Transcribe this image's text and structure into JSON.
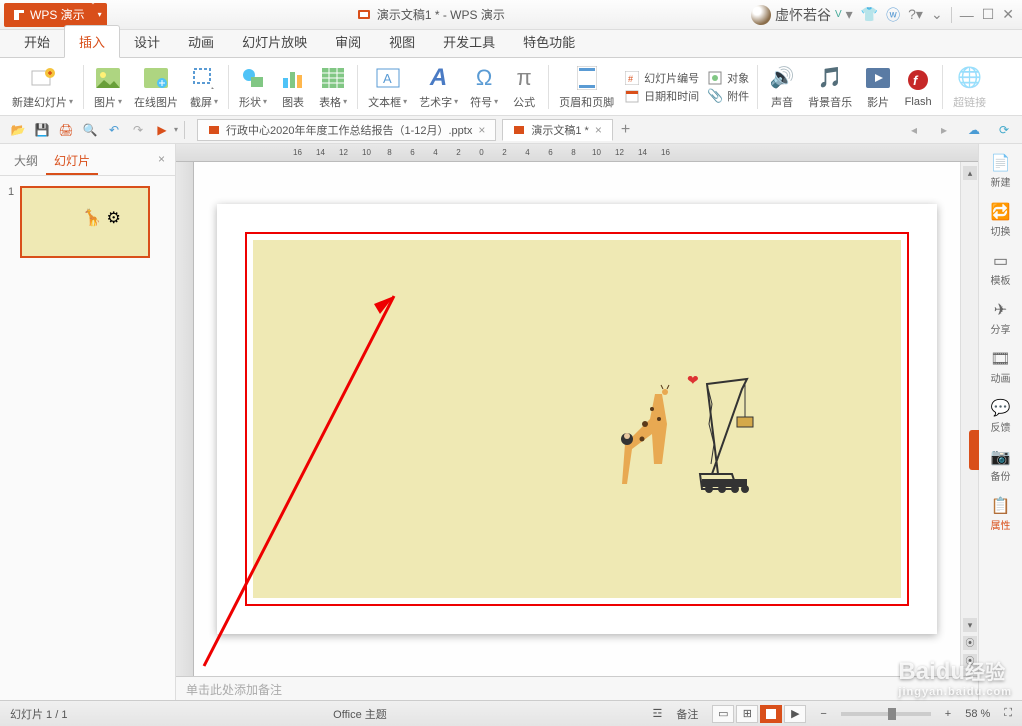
{
  "title": {
    "app": "WPS 演示",
    "doc": "演示文稿1 *",
    "full": "演示文稿1 * - WPS 演示",
    "user": "虚怀若谷"
  },
  "menu": [
    "开始",
    "插入",
    "设计",
    "动画",
    "幻灯片放映",
    "审阅",
    "视图",
    "开发工具",
    "特色功能"
  ],
  "menu_active": 1,
  "ribbon": {
    "new_slide": "新建幻灯片",
    "image": "图片",
    "online_img": "在线图片",
    "screenshot": "截屏",
    "shapes": "形状",
    "chart": "图表",
    "table": "表格",
    "textbox": "文本框",
    "wordart": "艺术字",
    "symbol": "符号",
    "formula": "公式",
    "header_footer": "页眉和页脚",
    "slide_num": "幻灯片编号",
    "date_time": "日期和时间",
    "object": "对象",
    "attachment": "附件",
    "audio": "声音",
    "bgm": "背景音乐",
    "movie": "影片",
    "flash": "Flash",
    "hyperlink": "超链接"
  },
  "doc_tabs": [
    {
      "name": "行政中心2020年年度工作总结报告（1-12月）.pptx",
      "active": false
    },
    {
      "name": "演示文稿1 *",
      "active": true
    }
  ],
  "thumb": {
    "tabs": [
      "大纲",
      "幻灯片"
    ],
    "active": 1,
    "slides": [
      {
        "num": "1"
      }
    ]
  },
  "ruler_marks": [
    "16",
    "14",
    "12",
    "10",
    "8",
    "6",
    "4",
    "2",
    "0",
    "2",
    "4",
    "6",
    "8",
    "10",
    "12",
    "14",
    "16"
  ],
  "notes_placeholder": "单击此处添加备注",
  "sidebar": [
    {
      "icon": "📄",
      "label": "新建"
    },
    {
      "icon": "🔁",
      "label": "切换"
    },
    {
      "icon": "▭",
      "label": "模板"
    },
    {
      "icon": "✈",
      "label": "分享"
    },
    {
      "icon": "🎞",
      "label": "动画"
    },
    {
      "icon": "💬",
      "label": "反馈"
    },
    {
      "icon": "📷",
      "label": "备份"
    },
    {
      "icon": "📋",
      "label": "属性"
    }
  ],
  "sidebar_active": 7,
  "status": {
    "slide": "幻灯片 1 / 1",
    "theme": "Office 主题",
    "notes": "备注",
    "zoom": "58 %"
  },
  "watermark": {
    "brand": "Baidu",
    "suffix": "经验",
    "url": "jingyan.baidu.com"
  }
}
